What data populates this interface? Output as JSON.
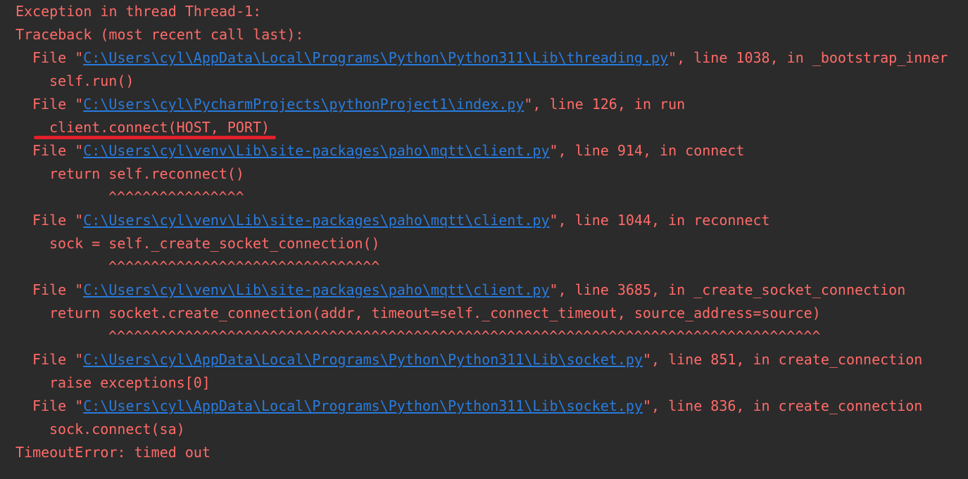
{
  "header": {
    "exception_line": "Exception in thread Thread-1:",
    "traceback_line": "Traceback (most recent call last):"
  },
  "frames": [
    {
      "file_prefix": "File \"",
      "path": "C:\\Users\\cyl\\AppData\\Local\\Programs\\Python\\Python311\\Lib\\threading.py",
      "suffix": "\", line 1038, in _bootstrap_inner",
      "code": "self.run()"
    },
    {
      "file_prefix": "File \"",
      "path": "C:\\Users\\cyl\\PycharmProjects\\pythonProject1\\index.py",
      "suffix": "\", line 126, in run",
      "code": "client.connect(HOST, PORT)"
    },
    {
      "file_prefix": "File \"",
      "path": "C:\\Users\\cyl\\venv\\Lib\\site-packages\\paho\\mqtt\\client.py",
      "suffix": "\", line 914, in connect",
      "code": "return self.reconnect()",
      "carets": "^^^^^^^^^^^^^^^^"
    },
    {
      "file_prefix": "File \"",
      "path": "C:\\Users\\cyl\\venv\\Lib\\site-packages\\paho\\mqtt\\client.py",
      "suffix": "\", line 1044, in reconnect",
      "code": "sock = self._create_socket_connection()",
      "carets": "^^^^^^^^^^^^^^^^^^^^^^^^^^^^^^^^"
    },
    {
      "file_prefix": "File \"",
      "path": "C:\\Users\\cyl\\venv\\Lib\\site-packages\\paho\\mqtt\\client.py",
      "suffix": "\", line 3685, in _create_socket_connection",
      "code": "return socket.create_connection(addr, timeout=self._connect_timeout, source_address=source)",
      "carets": "^^^^^^^^^^^^^^^^^^^^^^^^^^^^^^^^^^^^^^^^^^^^^^^^^^^^^^^^^^^^^^^^^^^^^^^^^^^^^^^^^^^^"
    },
    {
      "file_prefix": "File \"",
      "path": "C:\\Users\\cyl\\AppData\\Local\\Programs\\Python\\Python311\\Lib\\socket.py",
      "suffix": "\", line 851, in create_connection",
      "code": "raise exceptions[0]"
    },
    {
      "file_prefix": "File \"",
      "path": "C:\\Users\\cyl\\AppData\\Local\\Programs\\Python\\Python311\\Lib\\socket.py",
      "suffix": "\", line 836, in create_connection",
      "code": "sock.connect(sa)"
    }
  ],
  "footer": {
    "error_line": "TimeoutError: timed out"
  },
  "colors": {
    "background": "#2b2b2b",
    "error_text": "#ff6b68",
    "link": "#287bde",
    "annotation": "#e0202a"
  }
}
